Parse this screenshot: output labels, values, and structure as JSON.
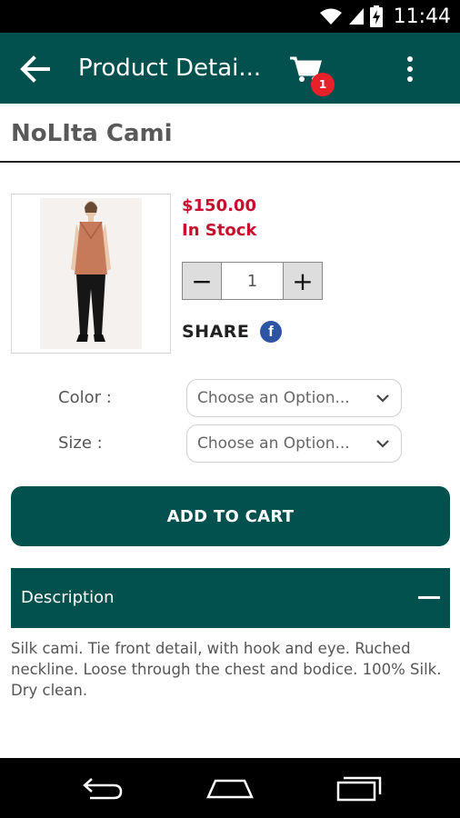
{
  "status_bar": {
    "time": "11:44",
    "icons": [
      "wifi-icon",
      "signal-icon",
      "battery-charging-icon"
    ]
  },
  "app_bar": {
    "title": "Product Detai...",
    "cart_badge": "1",
    "icons": [
      "back-arrow-icon",
      "cart-icon",
      "overflow-menu-icon"
    ]
  },
  "product": {
    "name": "NoLIta Cami",
    "price": "$150.00",
    "stock": "In Stock",
    "quantity": "1",
    "minus_label": "−",
    "plus_label": "+",
    "share_label": "SHARE",
    "facebook_glyph": "f"
  },
  "options": {
    "color_label": "Color :",
    "color_value": "Choose an Option...",
    "size_label": "Size :",
    "size_value": "Choose an Option..."
  },
  "actions": {
    "add_to_cart": "ADD TO CART"
  },
  "description": {
    "title": "Description",
    "body": "Silk cami. Tie front detail, with hook and eye. Ruched neckline. Loose through the chest and bodice. 100% Silk. Dry clean."
  },
  "colors": {
    "primary": "#03514f",
    "price_red": "#c8102e",
    "badge_red": "#e8202a",
    "facebook_blue": "#2d55a4"
  }
}
